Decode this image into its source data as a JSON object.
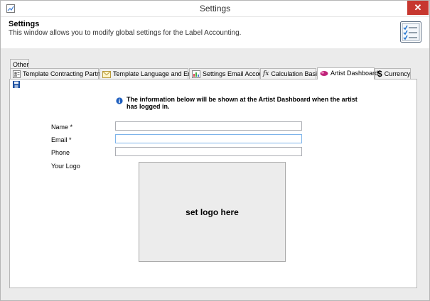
{
  "window": {
    "title": "Settings",
    "close_label": "✕"
  },
  "header": {
    "title": "Settings",
    "description": "This window allows you to modify global settings for the Label Accounting."
  },
  "tabs": {
    "row1": [
      {
        "label": "Other"
      }
    ],
    "row2": [
      {
        "label": "Template Contracting Partners",
        "icon": "partners-icon"
      },
      {
        "label": "Template Language and Email",
        "icon": "email-icon"
      },
      {
        "label": "Settings Email Account",
        "icon": "email-account-icon"
      },
      {
        "label": "Calculation Basis",
        "icon": "function-icon"
      },
      {
        "label": "Artist Dashboard",
        "icon": "dashboard-icon",
        "active": true
      },
      {
        "label": "Currency",
        "icon": "dollar-icon"
      }
    ]
  },
  "artist_dashboard": {
    "info_text": "The information below will be shown at the Artist Dashboard when the artist has logged in.",
    "fields": {
      "name": {
        "label": "Name *",
        "value": ""
      },
      "email": {
        "label": "Email *",
        "value": ""
      },
      "phone": {
        "label": "Phone",
        "value": ""
      }
    },
    "logo": {
      "label": "Your Logo",
      "placeholder": "set logo here"
    }
  },
  "colors": {
    "close": "#c7372f",
    "accent_focus": "#7eb4ea",
    "info_blue": "#1f5fbf"
  }
}
